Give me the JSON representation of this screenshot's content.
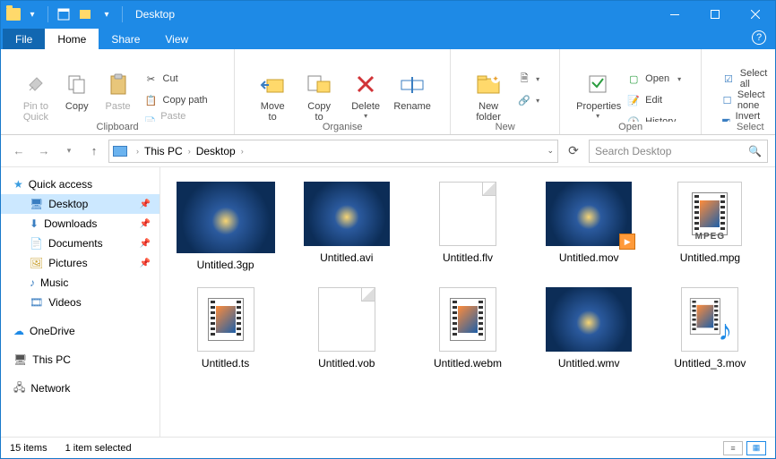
{
  "window": {
    "title": "Desktop"
  },
  "tabs": {
    "file": "File",
    "home": "Home",
    "share": "Share",
    "view": "View"
  },
  "ribbon": {
    "clipboard": {
      "label": "Clipboard",
      "pin": "Pin to Quick\naccess",
      "copy": "Copy",
      "paste": "Paste",
      "cut": "Cut",
      "copypath": "Copy path",
      "pasteshortcut": "Paste shortcut"
    },
    "organise": {
      "label": "Organise",
      "moveto": "Move\nto",
      "copyto": "Copy\nto",
      "delete": "Delete",
      "rename": "Rename"
    },
    "new": {
      "label": "New",
      "newfolder": "New\nfolder"
    },
    "open": {
      "label": "Open",
      "properties": "Properties",
      "open": "Open",
      "edit": "Edit",
      "history": "History"
    },
    "select": {
      "label": "Select",
      "selectall": "Select all",
      "selectnone": "Select none",
      "invert": "Invert selection"
    }
  },
  "address": {
    "crumbs": [
      "This PC",
      "Desktop"
    ],
    "search_placeholder": "Search Desktop"
  },
  "nav": {
    "quickaccess": "Quick access",
    "items": [
      {
        "label": "Desktop",
        "pinned": true,
        "selected": true,
        "icon": "monitor"
      },
      {
        "label": "Downloads",
        "pinned": true,
        "icon": "download"
      },
      {
        "label": "Documents",
        "pinned": true,
        "icon": "document"
      },
      {
        "label": "Pictures",
        "pinned": true,
        "icon": "pictures"
      },
      {
        "label": "Music",
        "pinned": false,
        "icon": "music"
      },
      {
        "label": "Videos",
        "pinned": false,
        "icon": "video"
      }
    ],
    "onedrive": "OneDrive",
    "thispc": "This PC",
    "network": "Network"
  },
  "files": [
    {
      "name": "Untitled.3gp",
      "thumb": "blue-big"
    },
    {
      "name": "Untitled.avi",
      "thumb": "blue"
    },
    {
      "name": "Untitled.flv",
      "thumb": "blank"
    },
    {
      "name": "Untitled.mov",
      "thumb": "blue-play"
    },
    {
      "name": "Untitled.mpg",
      "thumb": "mpeg"
    },
    {
      "name": "Untitled.ts",
      "thumb": "film"
    },
    {
      "name": "Untitled.vob",
      "thumb": "blank"
    },
    {
      "name": "Untitled.webm",
      "thumb": "film"
    },
    {
      "name": "Untitled.wmv",
      "thumb": "blue"
    },
    {
      "name": "Untitled_3.mov",
      "thumb": "note"
    }
  ],
  "status": {
    "count": "15 items",
    "selected": "1 item selected"
  }
}
